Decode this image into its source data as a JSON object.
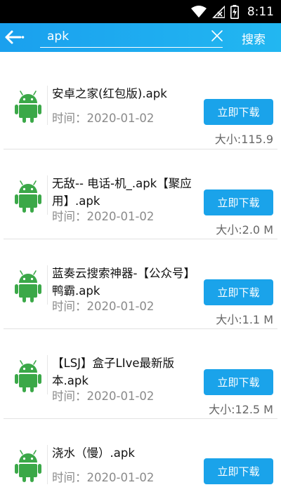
{
  "status_bar": {
    "time": "8:11"
  },
  "search": {
    "value": "apk",
    "button_label": "搜索"
  },
  "items": [
    {
      "name": "安卓之家(红包版).apk",
      "time": "时间：2020-01-02",
      "download_label": "立即下载",
      "size": "大小:115.9"
    },
    {
      "name": "无敌-- 电话-机_.apk【聚应用】.apk",
      "time": "时间：2020-01-02",
      "download_label": "立即下载",
      "size": "大小:2.0 M"
    },
    {
      "name": "蓝奏云搜索神器-【公众号】鸭霸.apk",
      "time": "时间：2020-01-02",
      "download_label": "立即下载",
      "size": "大小:1.1 M"
    },
    {
      "name": "【LSJ】盒子LIve最新版本.apk",
      "time": "时间：2020-01-02",
      "download_label": "立即下载",
      "size": "大小:12.5 M"
    },
    {
      "name": "浇水（慢）.apk",
      "time": "时间：2020-01-02",
      "download_label": "立即下载",
      "size": ""
    }
  ],
  "colors": {
    "accent": "#1aa3ea",
    "android_green": "#3ba848",
    "status_bar": "#000000"
  }
}
